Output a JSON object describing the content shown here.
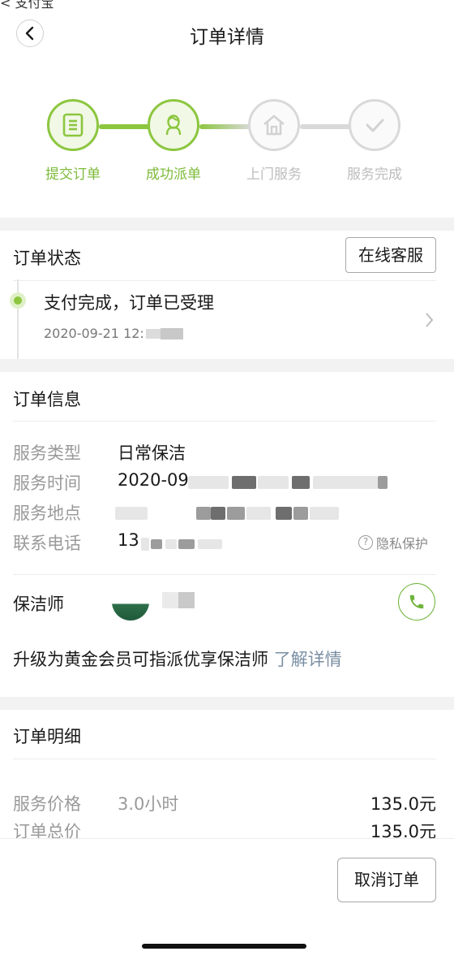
{
  "status_fragment": "< 支付宝",
  "header": {
    "title": "订单详情"
  },
  "progress": {
    "steps": [
      {
        "label": "提交订单",
        "state": "done",
        "icon": "list-icon"
      },
      {
        "label": "成功派单",
        "state": "done",
        "icon": "person-icon"
      },
      {
        "label": "上门服务",
        "state": "pending",
        "icon": "house-icon"
      },
      {
        "label": "服务完成",
        "state": "pending",
        "icon": "check-icon"
      }
    ],
    "active_color": "#8cc63f",
    "inactive_color": "#d9d9d9"
  },
  "order_status": {
    "title": "订单状态",
    "support_button": "在线客服",
    "event": {
      "text": "支付完成，订单已受理",
      "time": "2020-09-21 12:"
    }
  },
  "order_info": {
    "title": "订单信息",
    "rows": [
      {
        "label": "服务类型",
        "value": "日常保洁"
      },
      {
        "label": "服务时间",
        "value": "2020-09-"
      },
      {
        "label": "服务地点",
        "value": ""
      },
      {
        "label": "联系电话",
        "value": "13"
      }
    ],
    "privacy_label": "隐私保护",
    "cleaner_label": "保洁师",
    "upgrade_text": "升级为黄金会员可指派优享保洁师",
    "upgrade_link": "了解详情"
  },
  "order_detail": {
    "title": "订单明细",
    "rows": [
      {
        "label": "服务价格",
        "extra": "3.0小时",
        "value": "135.0元"
      },
      {
        "label": "订单总价",
        "value": "135.0元"
      }
    ]
  },
  "footer": {
    "cancel_button": "取消订单"
  },
  "colors": {
    "accent": "#8cc63f",
    "link": "#7a8fa3",
    "phone": "#6fb43a"
  }
}
